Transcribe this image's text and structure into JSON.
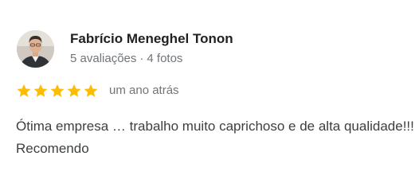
{
  "review": {
    "author_name": "Fabrício Meneghel Tonon",
    "reviews_count": "5 avaliações",
    "separator": "·",
    "photos_count": "4 fotos",
    "rating": 5,
    "max_rating": 5,
    "time_ago": "um ano atrás",
    "text": "Ótima empresa … trabalho muito caprichoso e de alta qualidade!!! Recomendo"
  },
  "icons": {
    "star": "star-icon",
    "avatar": "avatar"
  },
  "colors": {
    "star": "#fbbc04",
    "name": "#202124",
    "meta": "#70757a",
    "text": "#3c4043"
  }
}
